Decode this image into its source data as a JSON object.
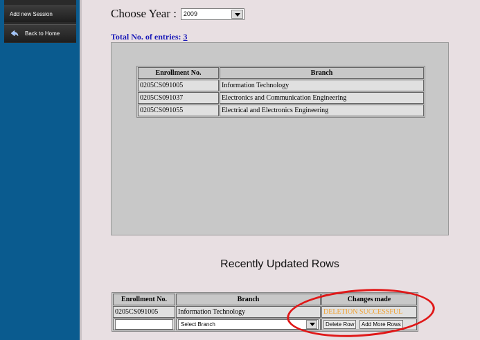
{
  "sidebar": {
    "items": [
      {
        "label": "Add new Session"
      },
      {
        "label": "Back to Home",
        "icon": "back-arrow-icon"
      }
    ]
  },
  "year": {
    "label": "Choose Year :",
    "selected": "2009"
  },
  "total": {
    "label": "Total No. of entries:",
    "count": "3"
  },
  "entries_table": {
    "headers": [
      "Enrollment No.",
      "Branch"
    ],
    "rows": [
      [
        "0205CS091005",
        "Information Technology"
      ],
      [
        "0205CS091037",
        "Electronics and Communication Engineering"
      ],
      [
        "0205CS091055",
        "Electrical and Electronics Engineering"
      ]
    ]
  },
  "recent": {
    "title": "Recently Updated Rows",
    "headers": [
      "Enrollment No.",
      "Branch",
      "Changes made"
    ],
    "rows": [
      [
        "0205CS091005",
        "Information Technology",
        "DELETION SUCCESSFUL"
      ]
    ],
    "input_row": {
      "enrollment_value": "",
      "branch_select": "Select Branch",
      "delete_button": "Delete Row",
      "add_button": "Add More Rows"
    }
  },
  "colors": {
    "sidebar": "#0a5b8f",
    "success_text": "#f0a030",
    "annotation": "#e01818"
  }
}
